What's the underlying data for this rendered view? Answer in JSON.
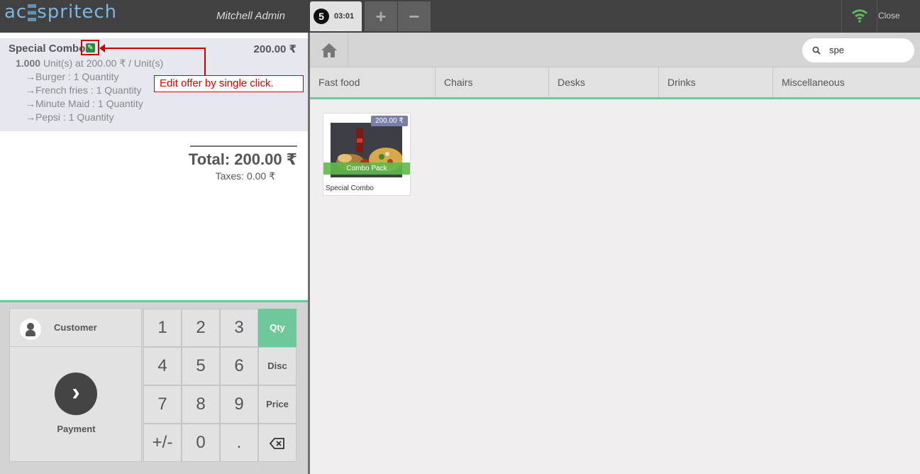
{
  "header": {
    "logo_text": "acespritech",
    "user": "Mitchell Admin",
    "order_number": "5",
    "order_time": "03:01",
    "add_order_label": "+",
    "remove_order_label": "−",
    "close_label": "Close",
    "wifi_color": "#5cb85c"
  },
  "orderline": {
    "product": "Special Combo",
    "price": "200.00 ₹",
    "quantity": "1.000",
    "unit_info": "Unit(s) at 200.00 ₹ / Unit(s)",
    "items": [
      "→Burger : 1 Quantity",
      "→French fries : 1 Quantity",
      "→Minute Maid : 1 Quantity",
      "→Pepsi : 1 Quantity"
    ],
    "edit_icon": "pencil-icon",
    "callout": "Edit offer by single click."
  },
  "summary": {
    "total": "Total: 200.00 ₹",
    "taxes": "Taxes: 0.00 ₹"
  },
  "actionpad": {
    "customer_label": "Customer",
    "payment_label": "Payment",
    "payment_icon": "chevron-right-icon"
  },
  "numpad": {
    "keys": [
      "1",
      "2",
      "3",
      "4",
      "5",
      "6",
      "7",
      "8",
      "9",
      "+/-",
      "0",
      "."
    ],
    "modes": [
      "Qty",
      "Disc",
      "Price"
    ],
    "active_mode": "Qty",
    "backspace_icon": "backspace-icon",
    "accent": "#6ec89b"
  },
  "products_screen": {
    "home_icon": "home-icon",
    "search_value": "spe",
    "categories": [
      "Fast food",
      "Chairs",
      "Desks",
      "Drinks",
      "Miscellaneous"
    ],
    "products": [
      {
        "name": "Special Combo",
        "price": "200.00 ₹",
        "ribbon": "Combo Pack"
      }
    ]
  }
}
